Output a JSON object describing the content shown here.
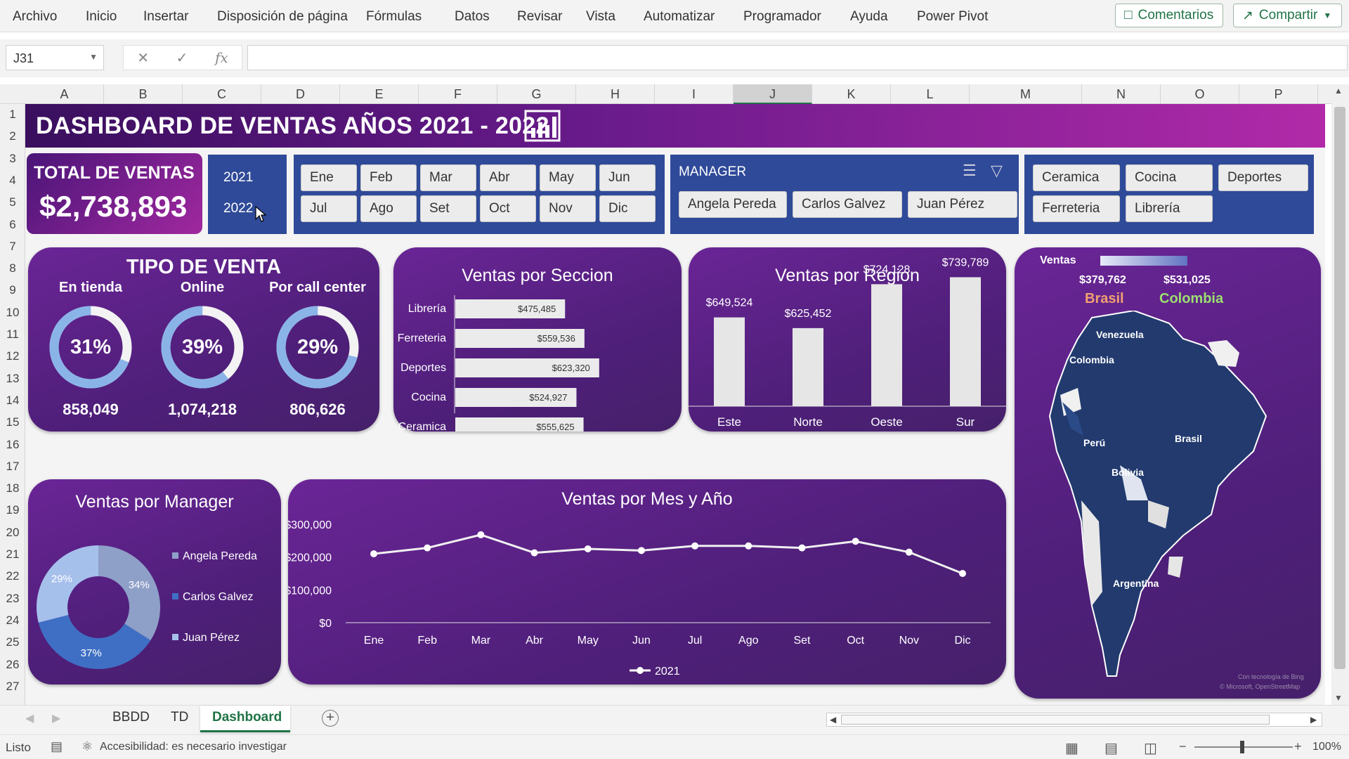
{
  "ribbon": {
    "tabs": [
      "Archivo",
      "Inicio",
      "Insertar",
      "Disposición de página",
      "Fórmulas",
      "Datos",
      "Revisar",
      "Vista",
      "Automatizar",
      "Programador",
      "Ayuda",
      "Power Pivot"
    ],
    "comments_label": "Comentarios",
    "share_label": "Compartir"
  },
  "formula_bar": {
    "name_box": "J31",
    "fx": "fx",
    "value": ""
  },
  "grid": {
    "columns": [
      "A",
      "B",
      "C",
      "D",
      "E",
      "F",
      "G",
      "H",
      "I",
      "J",
      "K",
      "L",
      "M",
      "N",
      "O",
      "P"
    ],
    "rows": [
      "1",
      "2",
      "3",
      "4",
      "5",
      "6",
      "7",
      "8",
      "9",
      "10",
      "11",
      "12",
      "13",
      "14",
      "15",
      "16",
      "17",
      "18",
      "19",
      "20",
      "21",
      "22",
      "23",
      "24",
      "25",
      "26",
      "27"
    ]
  },
  "dashboard": {
    "title": "DASHBOARD DE VENTAS AÑOS 2021 - 2022",
    "total_label": "TOTAL DE VENTAS",
    "total_value": "$2,738,893",
    "years": [
      "2021",
      "2022"
    ],
    "months": [
      "Ene",
      "Feb",
      "Mar",
      "Abr",
      "May",
      "Jun",
      "Jul",
      "Ago",
      "Set",
      "Oct",
      "Nov",
      "Dic"
    ],
    "manager_slicer": {
      "title": "MANAGER",
      "items": [
        "Angela Pereda",
        "Carlos Galvez",
        "Juan Pérez"
      ]
    },
    "section_slicer": {
      "items": [
        "Ceramica",
        "Cocina",
        "Deportes",
        "Ferreteria",
        "Librería"
      ]
    },
    "tipo_venta": {
      "title": "TIPO DE VENTA",
      "items": [
        {
          "label": "En tienda",
          "percent": "31%",
          "value": "858,049",
          "fraction": 0.31
        },
        {
          "label": "Online",
          "percent": "39%",
          "value": "1,074,218",
          "fraction": 0.39
        },
        {
          "label": "Por call center",
          "percent": "29%",
          "value": "806,626",
          "fraction": 0.29
        }
      ]
    },
    "mapa": {
      "legend_label": "Ventas",
      "min_value": "$379,762",
      "max_value": "$531,025",
      "min_country": "Brasil",
      "max_country": "Colombia",
      "labels": [
        "Venezuela",
        "Colombia",
        "Perú",
        "Brasil",
        "Bolivia",
        "Argentina"
      ],
      "credit1": "Con tecnología de Bing",
      "credit2": "© Microsoft, OpenStreetMap"
    },
    "colors": {
      "panel": "#5a2186",
      "blue": "#2f4a98",
      "bar": "#e6e6e6",
      "ring": "#8ab4e8"
    }
  },
  "chart_data": [
    {
      "type": "bar",
      "title": "Ventas por Seccion",
      "orientation": "horizontal",
      "categories": [
        "Librería",
        "Ferreteria",
        "Deportes",
        "Cocina",
        "Ceramica"
      ],
      "values": [
        475485,
        559536,
        623320,
        524927,
        555625
      ],
      "labels": [
        "$475,485",
        "$559,536",
        "$623,320",
        "$524,927",
        "$555,625"
      ]
    },
    {
      "type": "bar",
      "title": "Ventas por Region",
      "categories": [
        "Este",
        "Norte",
        "Oeste",
        "Sur"
      ],
      "values": [
        649524,
        625452,
        724128,
        739789
      ],
      "labels": [
        "$649,524",
        "$625,452",
        "$724,128",
        "$739,789"
      ]
    },
    {
      "type": "pie",
      "title": "Ventas por Manager",
      "categories": [
        "Angela Pereda",
        "Carlos Galvez",
        "Juan Pérez"
      ],
      "values": [
        34,
        37,
        29
      ],
      "labels": [
        "34%",
        "37%",
        "29%"
      ],
      "colors": [
        "#8e9fc8",
        "#3f6fc4",
        "#a6c0ec"
      ]
    },
    {
      "type": "line",
      "title": "Ventas por Mes y Año",
      "categories": [
        "Ene",
        "Feb",
        "Mar",
        "Abr",
        "May",
        "Jun",
        "Jul",
        "Ago",
        "Set",
        "Oct",
        "Nov",
        "Dic"
      ],
      "series": [
        {
          "name": "2021",
          "values": [
            210000,
            228000,
            268000,
            213000,
            225000,
            220000,
            234000,
            234000,
            228000,
            248000,
            215000,
            150000
          ]
        }
      ],
      "yticks": [
        "$300,000",
        "$200,000",
        "$100,000",
        "$0"
      ],
      "ylim": [
        0,
        300000
      ]
    }
  ],
  "sheet_tabs": [
    "BBDD",
    "TD",
    "Dashboard"
  ],
  "active_sheet": "Dashboard",
  "status": {
    "ready": "Listo",
    "accessibility": "Accesibilidad: es necesario investigar",
    "zoom": "100%"
  }
}
